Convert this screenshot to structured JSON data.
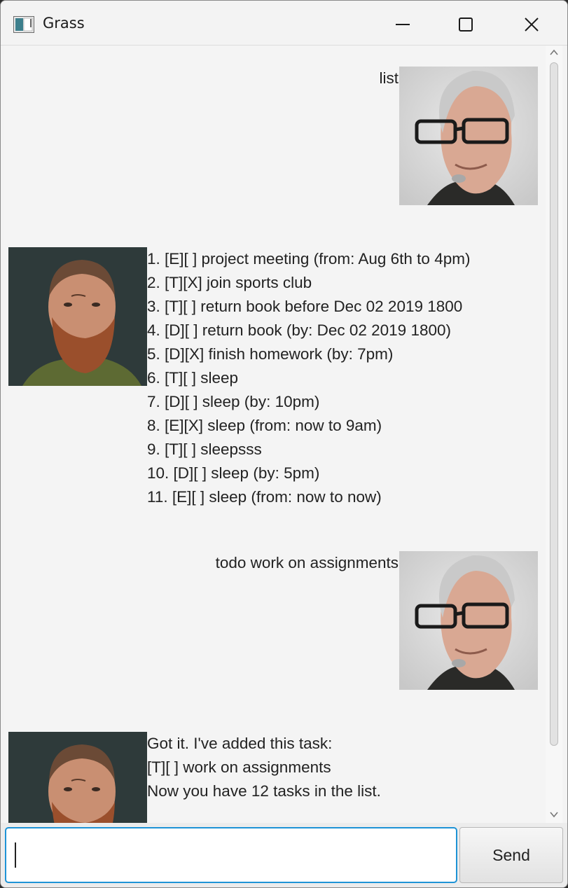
{
  "window": {
    "title": "Grass"
  },
  "chat": {
    "messages": [
      {
        "sender": "user",
        "lines": [
          "list"
        ]
      },
      {
        "sender": "bot",
        "lines": [
          "1. [E][ ] project meeting (from: Aug 6th to 4pm)",
          "2. [T][X] join sports club",
          "3. [T][ ] return book before Dec 02 2019 1800",
          "4. [D][ ] return book (by: Dec 02 2019 1800)",
          "5. [D][X] finish homework (by: 7pm)",
          "6. [T][ ] sleep",
          "7. [D][ ] sleep (by: 10pm)",
          "8. [E][X] sleep (from: now to 9am)",
          "9. [T][ ] sleepsss",
          "10. [D][ ] sleep (by: 5pm)",
          "11. [E][ ] sleep (from: now to now)"
        ]
      },
      {
        "sender": "user",
        "lines": [
          "todo work on assignments"
        ]
      },
      {
        "sender": "bot",
        "lines": [
          "Got it. I've added this task:",
          "[T][ ] work on assignments",
          "Now you have 12 tasks in the list."
        ]
      }
    ]
  },
  "input": {
    "value": "",
    "placeholder": ""
  },
  "send_button": {
    "label": "Send"
  },
  "icons": {
    "app": "app-window-icon",
    "minimize": "minimize-icon",
    "maximize": "maximize-icon",
    "close": "close-icon",
    "user_avatar": "user-avatar",
    "bot_avatar": "bot-avatar"
  },
  "colors": {
    "input_focus": "#1e93d6",
    "chat_bg": "#f4f4f4"
  }
}
